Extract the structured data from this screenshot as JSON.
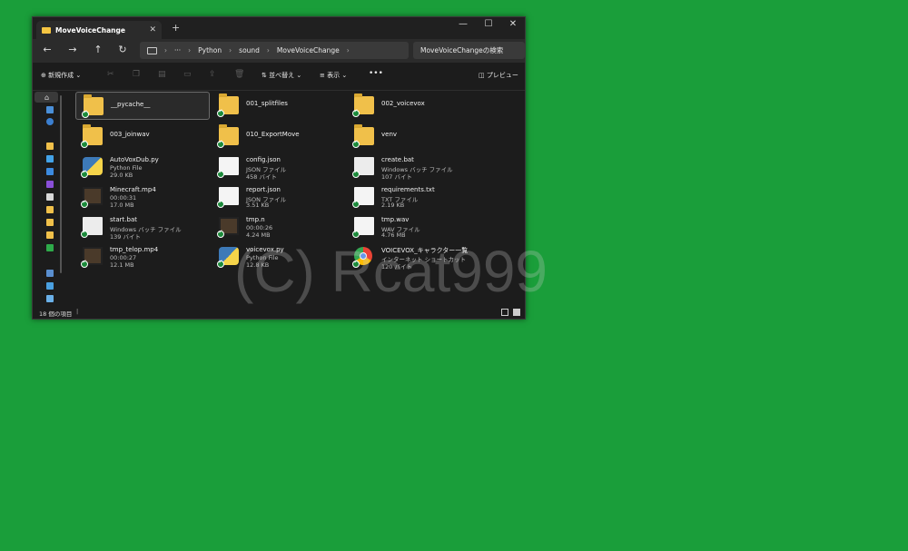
{
  "window": {
    "tab_title": "MoveVoiceChange",
    "tab_close": "✕",
    "new_tab": "+",
    "minimize": "—",
    "maximize": "☐",
    "close": "✕"
  },
  "nav": {
    "back": "←",
    "forward": "→",
    "up": "↑",
    "refresh": "↻",
    "more": "···",
    "breadcrumbs": [
      "Python",
      "sound",
      "MoveVoiceChange"
    ],
    "search_placeholder": "MoveVoiceChangeの検索"
  },
  "toolbar": {
    "new_label": "新規作成",
    "sort_label": "並べ替え",
    "view_label": "表示",
    "more": "•••",
    "preview_label": "プレビュー"
  },
  "items": [
    {
      "name": "__pycache__",
      "type": "folder"
    },
    {
      "name": "001_splitfiles",
      "type": "folder"
    },
    {
      "name": "002_voicevox",
      "type": "folder"
    },
    {
      "name": "003_joinwav",
      "type": "folder"
    },
    {
      "name": "010_ExportMove",
      "type": "folder"
    },
    {
      "name": "venv",
      "type": "folder"
    },
    {
      "name": "AutoVoxDub.py",
      "line2": "Python File",
      "line3": "29.0 KB",
      "type": "python"
    },
    {
      "name": "config.json",
      "line2": "JSON ファイル",
      "line3": "458 バイト",
      "type": "json"
    },
    {
      "name": "create.bat",
      "line2": "Windows バッチ ファイル",
      "line3": "107 バイト",
      "type": "bat"
    },
    {
      "name": "Minecraft.mp4",
      "line2": "00:00:31",
      "line3": "17.0 MB",
      "type": "video"
    },
    {
      "name": "report.json",
      "line2": "JSON ファイル",
      "line3": "3.51 KB",
      "type": "json"
    },
    {
      "name": "requirements.txt",
      "line2": "TXT ファイル",
      "line3": "2.19 KB",
      "type": "txt"
    },
    {
      "name": "start.bat",
      "line2": "Windows バッチ ファイル",
      "line3": "139 バイト",
      "type": "bat"
    },
    {
      "name": "tmp.n",
      "line2": "00:00:26",
      "line3": "4.24 MB",
      "type": "video"
    },
    {
      "name": "tmp.wav",
      "line2": "WAV ファイル",
      "line3": "4.76 MB",
      "type": "wav"
    },
    {
      "name": "tmp_telop.mp4",
      "line2": "00:00:27",
      "line3": "12.1 MB",
      "type": "video"
    },
    {
      "name": "voicevox.py",
      "line2": "Python File",
      "line3": "12.8 KB",
      "type": "python"
    },
    {
      "name": "VOICEVOX_キャラクター一覧",
      "line2": "インターネット ショートカット",
      "line3": "120 バイト",
      "type": "chrome"
    }
  ],
  "status": {
    "count": "18 個の項目"
  },
  "watermark": "(C) Rcat999"
}
